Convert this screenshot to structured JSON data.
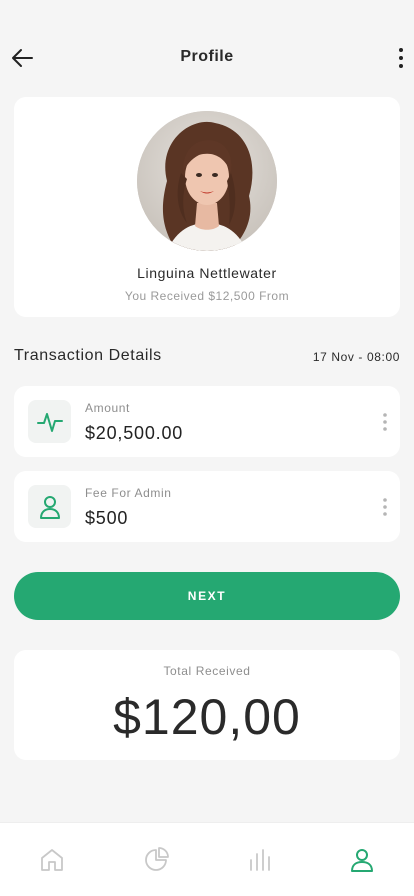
{
  "header": {
    "title": "Profile",
    "back_icon": "arrow-left-icon",
    "menu_icon": "vertical-dots-icon"
  },
  "profile": {
    "name": "Linguina Nettlewater",
    "subtitle": "You Received $12,500 From"
  },
  "transaction": {
    "heading": "Transaction Details",
    "date": "17 Nov - 08:00",
    "items": [
      {
        "label": "Amount",
        "value": "$20,500.00",
        "icon": "activity-pulse-icon"
      },
      {
        "label": "Fee For Admin",
        "value": "$500",
        "icon": "user-icon"
      }
    ]
  },
  "actions": {
    "next_label": "NEXT"
  },
  "total": {
    "label": "Total Received",
    "amount": "$120,00"
  },
  "nav": {
    "items": [
      {
        "icon": "home-icon",
        "active": false
      },
      {
        "icon": "pie-chart-icon",
        "active": false
      },
      {
        "icon": "bar-chart-icon",
        "active": false
      },
      {
        "icon": "user-icon",
        "active": true
      }
    ]
  },
  "colors": {
    "accent": "#25a872",
    "background": "#f5f5f5",
    "card": "#ffffff",
    "inactive_icon": "#c8c8c8"
  }
}
